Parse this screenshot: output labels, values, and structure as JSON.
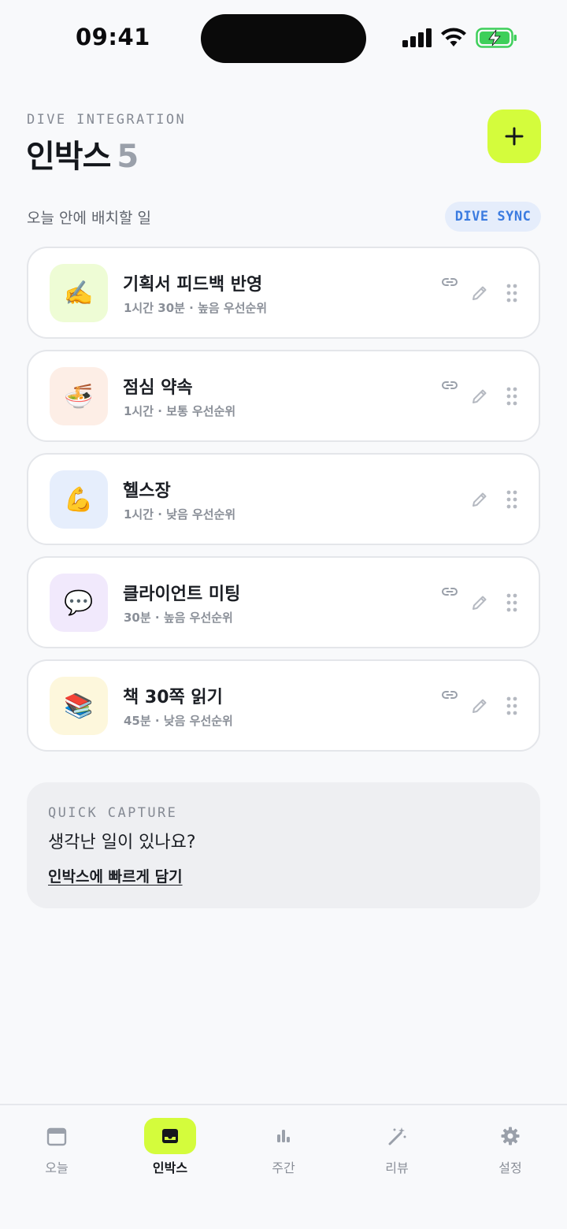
{
  "status_bar": {
    "time": "09:41"
  },
  "header": {
    "eyebrow": "DIVE INTEGRATION",
    "title": "인박스",
    "count": "5"
  },
  "section": {
    "label": "오늘 안에 배치할 일",
    "sync_badge": "DIVE SYNC"
  },
  "tasks": [
    {
      "emoji": "✍️",
      "emoji_bg": "#eefcd5",
      "title": "기획서 피드백 반영",
      "meta": "1시간 30분 · 높음 우선순위",
      "linked": true
    },
    {
      "emoji": "🍜",
      "emoji_bg": "#fdeee6",
      "title": "점심 약속",
      "meta": "1시간 · 보통 우선순위",
      "linked": true
    },
    {
      "emoji": "💪",
      "emoji_bg": "#e6eefc",
      "title": "헬스장",
      "meta": "1시간 · 낮음 우선순위",
      "linked": false
    },
    {
      "emoji": "💬",
      "emoji_bg": "#f1e9fc",
      "title": "클라이언트 미팅",
      "meta": "30분 · 높음 우선순위",
      "linked": true
    },
    {
      "emoji": "📚",
      "emoji_bg": "#fdf7dc",
      "title": "책 30쪽 읽기",
      "meta": "45분 · 낮음 우선순위",
      "linked": true
    }
  ],
  "quick_capture": {
    "eyebrow": "QUICK CAPTURE",
    "title": "생각난 일이 있나요?",
    "link": "인박스에 빠르게 담기"
  },
  "tab_bar": {
    "items": [
      {
        "label": "오늘",
        "icon": "calendar-icon",
        "active": false
      },
      {
        "label": "인박스",
        "icon": "inbox-icon",
        "active": true
      },
      {
        "label": "주간",
        "icon": "bar-chart-icon",
        "active": false
      },
      {
        "label": "리뷰",
        "icon": "magic-wand-icon",
        "active": false
      },
      {
        "label": "설정",
        "icon": "gear-icon",
        "active": false
      }
    ]
  },
  "colors": {
    "accent": "#d4fc3c",
    "sync_badge_text": "#3b7be0",
    "sync_badge_bg": "#e5edfb",
    "battery": "#3ecf5a"
  }
}
